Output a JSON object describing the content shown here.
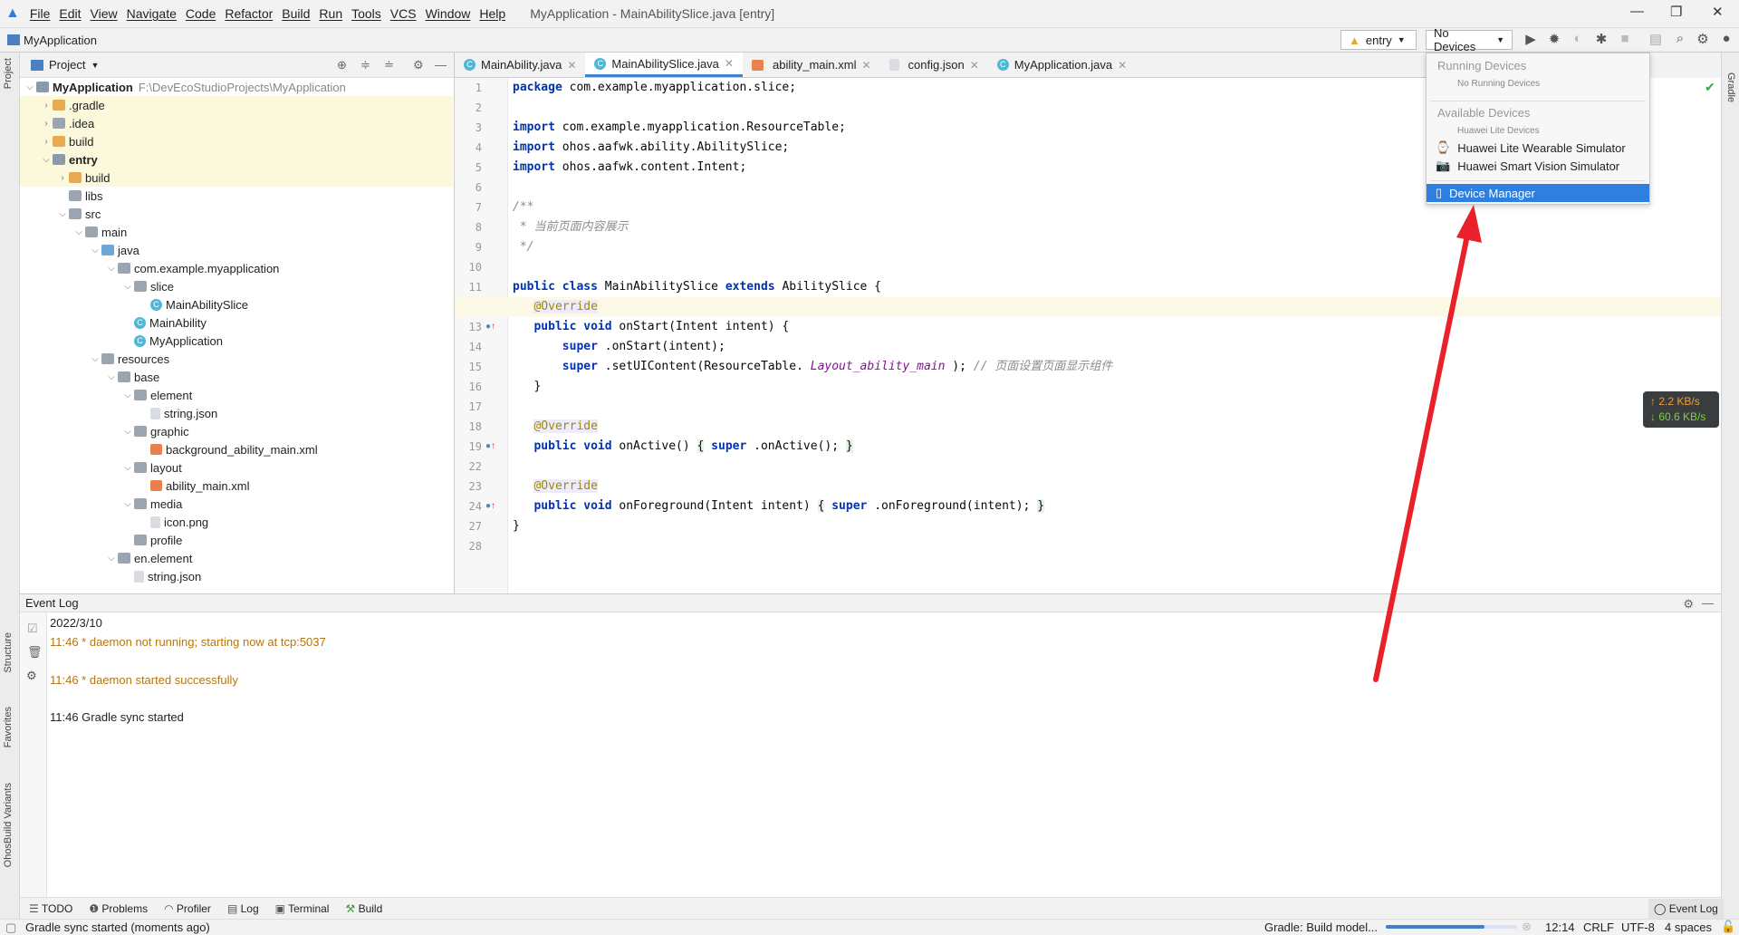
{
  "menu": {
    "items": [
      "File",
      "Edit",
      "View",
      "Navigate",
      "Code",
      "Refactor",
      "Build",
      "Run",
      "Tools",
      "VCS",
      "Window",
      "Help"
    ],
    "window_title": "MyApplication - MainAbilitySlice.java [entry]"
  },
  "nav": {
    "project": "MyApplication",
    "config": "entry",
    "device": "No Devices"
  },
  "project_panel": {
    "title": "Project",
    "tree": [
      {
        "l": 0,
        "t": "MyApplication",
        "e": "open",
        "i": "f-mod",
        "b": true,
        "path": "F:\\DevEcoStudioProjects\\MyApplication"
      },
      {
        "l": 1,
        "t": ".gradle",
        "e": "closed",
        "i": "f-orange",
        "h": true
      },
      {
        "l": 1,
        "t": ".idea",
        "e": "closed",
        "i": "f-folder",
        "h": true
      },
      {
        "l": 1,
        "t": "build",
        "e": "closed",
        "i": "f-orange",
        "h": true
      },
      {
        "l": 1,
        "t": "entry",
        "e": "open",
        "i": "f-mod",
        "b": true,
        "h": true
      },
      {
        "l": 2,
        "t": "build",
        "e": "closed",
        "i": "f-orange",
        "h": true
      },
      {
        "l": 2,
        "t": "libs",
        "e": "",
        "i": "f-folder"
      },
      {
        "l": 2,
        "t": "src",
        "e": "open",
        "i": "f-folder"
      },
      {
        "l": 3,
        "t": "main",
        "e": "open",
        "i": "f-folder"
      },
      {
        "l": 4,
        "t": "java",
        "e": "open",
        "i": "f-blue"
      },
      {
        "l": 5,
        "t": "com.example.myapplication",
        "e": "open",
        "i": "f-folder"
      },
      {
        "l": 6,
        "t": "slice",
        "e": "open",
        "i": "f-folder"
      },
      {
        "l": 7,
        "t": "MainAbilitySlice",
        "e": "",
        "i": "f-class"
      },
      {
        "l": 6,
        "t": "MainAbility",
        "e": "",
        "i": "f-class"
      },
      {
        "l": 6,
        "t": "MyApplication",
        "e": "",
        "i": "f-class"
      },
      {
        "l": 4,
        "t": "resources",
        "e": "open",
        "i": "f-folder"
      },
      {
        "l": 5,
        "t": "base",
        "e": "open",
        "i": "f-folder"
      },
      {
        "l": 6,
        "t": "element",
        "e": "open",
        "i": "f-folder"
      },
      {
        "l": 7,
        "t": "string.json",
        "e": "",
        "i": "f-file"
      },
      {
        "l": 6,
        "t": "graphic",
        "e": "open",
        "i": "f-folder"
      },
      {
        "l": 7,
        "t": "background_ability_main.xml",
        "e": "",
        "i": "f-xml"
      },
      {
        "l": 6,
        "t": "layout",
        "e": "open",
        "i": "f-folder"
      },
      {
        "l": 7,
        "t": "ability_main.xml",
        "e": "",
        "i": "f-xml"
      },
      {
        "l": 6,
        "t": "media",
        "e": "open",
        "i": "f-folder"
      },
      {
        "l": 7,
        "t": "icon.png",
        "e": "",
        "i": "f-file"
      },
      {
        "l": 6,
        "t": "profile",
        "e": "",
        "i": "f-folder"
      },
      {
        "l": 5,
        "t": "en.element",
        "e": "open",
        "i": "f-folder"
      },
      {
        "l": 6,
        "t": "string.json",
        "e": "",
        "i": "f-file"
      }
    ]
  },
  "editor": {
    "tabs": [
      {
        "label": "MainAbility.java",
        "icon": "class"
      },
      {
        "label": "MainAbilitySlice.java",
        "icon": "class",
        "active": true
      },
      {
        "label": "ability_main.xml",
        "icon": "xml"
      },
      {
        "label": "config.json",
        "icon": "json"
      },
      {
        "label": "MyApplication.java",
        "icon": "class"
      }
    ],
    "current_line": 12,
    "lines": [
      {
        "n": "1",
        "c": [
          [
            "kw",
            "package"
          ],
          [
            "",
            "com.example.myapplication.slice;"
          ]
        ]
      },
      {
        "n": "2",
        "c": []
      },
      {
        "n": "3",
        "c": [
          [
            "kw",
            "import"
          ],
          [
            "",
            "com.example.myapplication.ResourceTable;"
          ]
        ]
      },
      {
        "n": "4",
        "c": [
          [
            "kw",
            "import"
          ],
          [
            "",
            "ohos.aafwk.ability.AbilitySlice;"
          ]
        ]
      },
      {
        "n": "5",
        "c": [
          [
            "kw",
            "import"
          ],
          [
            "",
            "ohos.aafwk.content.Intent;"
          ]
        ]
      },
      {
        "n": "6",
        "c": []
      },
      {
        "n": "7",
        "c": [
          [
            "cm",
            "/**"
          ]
        ]
      },
      {
        "n": "8",
        "c": [
          [
            "cm",
            " * 当前页面内容展示"
          ]
        ]
      },
      {
        "n": "9",
        "c": [
          [
            "cm",
            " */"
          ]
        ]
      },
      {
        "n": "10",
        "c": []
      },
      {
        "n": "11",
        "c": [
          [
            "kw",
            "public class"
          ],
          [
            "",
            "MainAbilitySlice"
          ],
          [
            "kw",
            "extends"
          ],
          [
            "",
            "AbilitySlice {"
          ]
        ]
      },
      {
        "n": "12",
        "c": [
          [
            "",
            "   "
          ],
          [
            "an",
            "@Override"
          ]
        ]
      },
      {
        "n": "13",
        "o": true,
        "c": [
          [
            "",
            "   "
          ],
          [
            "kw",
            "public void"
          ],
          [
            "",
            "onStart(Intent intent) {"
          ]
        ]
      },
      {
        "n": "14",
        "c": [
          [
            "",
            "       "
          ],
          [
            "kw",
            "super"
          ],
          [
            "",
            ".onStart(intent);"
          ]
        ]
      },
      {
        "n": "15",
        "c": [
          [
            "",
            "       "
          ],
          [
            "kw",
            "super"
          ],
          [
            "",
            ".setUIContent(ResourceTable."
          ],
          [
            "it",
            "Layout_ability_main"
          ],
          [
            "",
            ");"
          ],
          [
            "cm",
            "// 页面设置页面显示组件"
          ]
        ]
      },
      {
        "n": "16",
        "c": [
          [
            "",
            "   }"
          ]
        ]
      },
      {
        "n": "17",
        "c": []
      },
      {
        "n": "18",
        "c": [
          [
            "",
            "   "
          ],
          [
            "an",
            "@Override"
          ]
        ]
      },
      {
        "n": "19",
        "o": true,
        "c": [
          [
            "",
            "   "
          ],
          [
            "kw",
            "public void"
          ],
          [
            "",
            "onActive()"
          ],
          [
            "br",
            "{"
          ],
          [
            "kw",
            "super"
          ],
          [
            "",
            ".onActive();"
          ],
          [
            "br",
            "}"
          ]
        ]
      },
      {
        "n": "22",
        "c": []
      },
      {
        "n": "23",
        "c": [
          [
            "",
            "   "
          ],
          [
            "an",
            "@Override"
          ]
        ]
      },
      {
        "n": "24",
        "o": true,
        "c": [
          [
            "",
            "   "
          ],
          [
            "kw",
            "public void"
          ],
          [
            "",
            "onForeground(Intent intent)"
          ],
          [
            "br",
            "{"
          ],
          [
            "kw",
            "super"
          ],
          [
            "",
            ".onForeground(intent);"
          ],
          [
            "br",
            "}"
          ]
        ]
      },
      {
        "n": "27",
        "c": [
          [
            "",
            "}"
          ]
        ]
      },
      {
        "n": "28",
        "c": []
      }
    ]
  },
  "devices_dropdown": {
    "running_header": "Running Devices",
    "running_none": "No Running Devices",
    "available_header": "Available Devices",
    "lite_group": "Huawei Lite Devices",
    "items": [
      "Huawei Lite Wearable Simulator",
      "Huawei Smart Vision Simulator"
    ],
    "device_manager": "Device Manager"
  },
  "net_speed": {
    "up": "↑ 2.2 KB/s",
    "down": "↓ 60.6 KB/s"
  },
  "event_log": {
    "title": "Event Log",
    "date": "2022/3/10",
    "entries": [
      {
        "text": "11:46  * daemon not running; starting now at tcp:5037",
        "color": "#b5760f"
      },
      {
        "text": "11:46  * daemon started successfully",
        "color": "#b5760f"
      },
      {
        "text": "11:46  Gradle sync started",
        "color": "#222222"
      }
    ]
  },
  "tool_tabs": [
    "TODO",
    "Problems",
    "Profiler",
    "Log",
    "Terminal",
    "Build"
  ],
  "side_labels": {
    "project": "Project",
    "structure": "Structure",
    "favorites": "Favorites",
    "variants": "OhosBuild Variants",
    "gradle": "Gradle"
  },
  "status": {
    "message": "Gradle sync started (moments ago)",
    "task": "Gradle: Build model...",
    "progress": 0.75,
    "position": "12:14",
    "line_sep": "CRLF",
    "encoding": "UTF-8",
    "indent": "4 spaces",
    "event_log": "Event Log"
  },
  "colors": {
    "accent": "#2f7fe0",
    "annotation_arrow": "#e8212b"
  }
}
